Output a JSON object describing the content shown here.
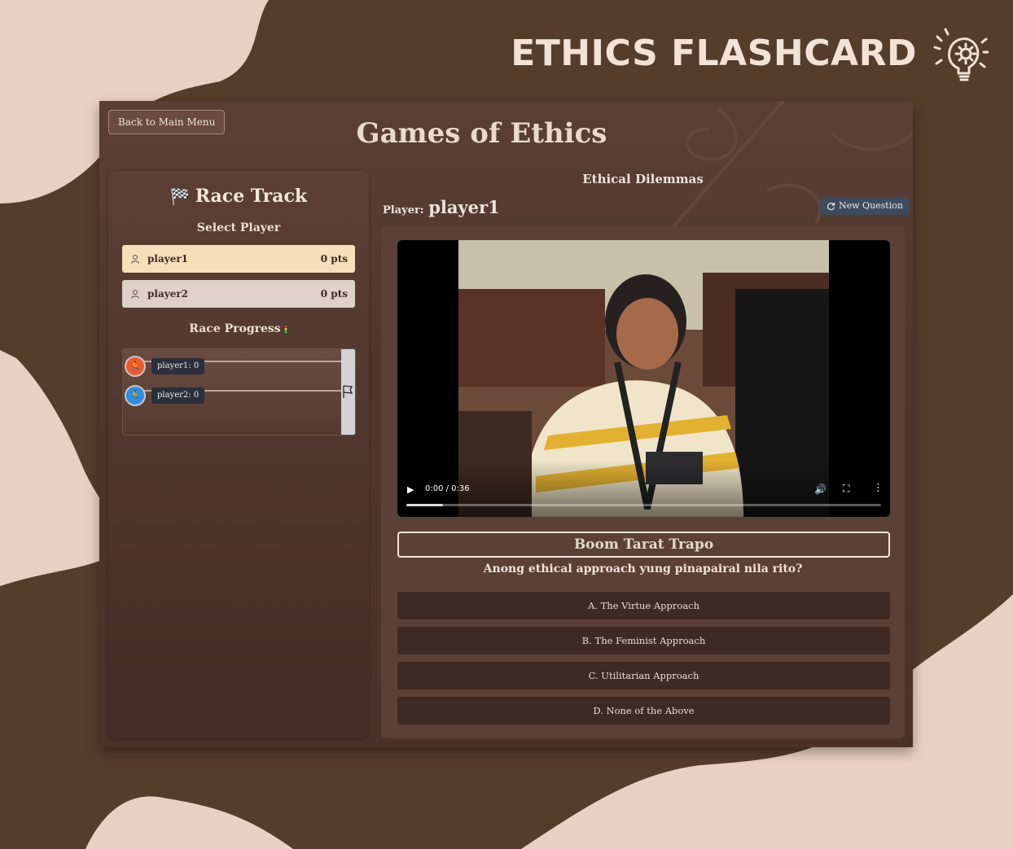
{
  "brand": {
    "title": "ETHICS FLASHCARD",
    "icon": "lightbulb-gear-icon"
  },
  "app": {
    "back_label": "Back to Main Menu",
    "title": "Games of Ethics"
  },
  "sidebar": {
    "title": "Race Track",
    "title_icon": "checkered-flag-icon",
    "select_player_label": "Select Player",
    "players": [
      {
        "name": "player1",
        "points": "0 pts"
      },
      {
        "name": "player2",
        "points": "0 pts"
      }
    ],
    "progress_title": "Race Progress",
    "progress_icon": "traffic-light-icon",
    "runners": [
      {
        "label": "player1: 0",
        "color": "#ee5a2b",
        "progress": 0
      },
      {
        "label": "player2: 0",
        "color": "#2f8ee3",
        "progress": 0
      }
    ],
    "finish_icon": "flag-icon"
  },
  "main": {
    "section_title": "Ethical Dilemmas",
    "player_label": "Player:",
    "player_name": "player1",
    "new_question_label": "New Question",
    "video": {
      "time": "0:00 / 0:36",
      "buffered_fraction": 0.08
    },
    "question_title": "Boom Tarat Trapo",
    "question": "Anong ethical approach yung pinapairal nila rito?",
    "answers": [
      "A. The Virtue Approach",
      "B. The Feminist Approach",
      "C. Utilitarian Approach",
      "D. None of the Above"
    ]
  },
  "colors": {
    "page_bg": "#e8d0c3",
    "blob": "#553d2c",
    "app_bg": "#4e362e",
    "player1_row": "#f6dfb9",
    "player2_row": "#ddd1ca",
    "answer_bg": "#3f2924",
    "new_question_bg": "#3f4b5c"
  }
}
